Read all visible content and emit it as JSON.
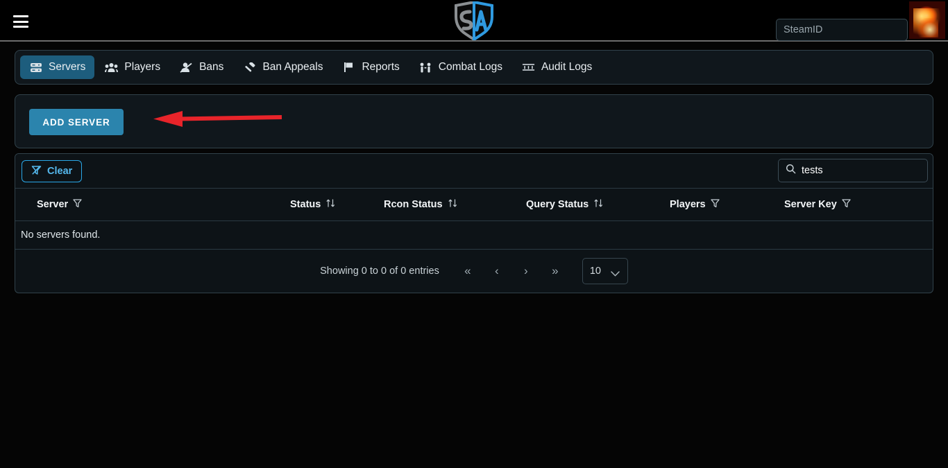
{
  "topbar": {
    "menu_icon": "hamburger-icon",
    "logo_alt": "SA shield logo",
    "logo_letters": "SA",
    "steamid": {
      "placeholder": "SteamID",
      "value": ""
    },
    "avatar_alt": "user-avatar"
  },
  "nav": {
    "items": [
      {
        "label": "Servers",
        "icon": "server-icon",
        "active": true
      },
      {
        "label": "Players",
        "icon": "users-icon",
        "active": false
      },
      {
        "label": "Bans",
        "icon": "user-slash-icon",
        "active": false
      },
      {
        "label": "Ban Appeals",
        "icon": "gavel-icon",
        "active": false
      },
      {
        "label": "Reports",
        "icon": "flag-icon",
        "active": false
      },
      {
        "label": "Combat Logs",
        "icon": "people-arrows-icon",
        "active": false
      },
      {
        "label": "Audit Logs",
        "icon": "list-lines-icon",
        "active": false
      }
    ]
  },
  "actions": {
    "add_server_label": "ADD SERVER",
    "annotation_arrow": {
      "color": "#e8242a",
      "direction": "left"
    }
  },
  "toolbar": {
    "clear_label": "Clear",
    "clear_icon": "filter-slash-icon",
    "search": {
      "icon": "search-icon",
      "value": "tests",
      "placeholder": ""
    }
  },
  "table": {
    "columns": [
      {
        "label": "Server",
        "control": "filter"
      },
      {
        "label": "Status",
        "control": "sort"
      },
      {
        "label": "Rcon Status",
        "control": "sort"
      },
      {
        "label": "Query Status",
        "control": "sort"
      },
      {
        "label": "Players",
        "control": "filter"
      },
      {
        "label": "Server Key",
        "control": "filter"
      }
    ],
    "rows": [],
    "empty_message": "No servers found."
  },
  "pagination": {
    "showing": "Showing 0 to 0 of 0 entries",
    "first": "«",
    "prev": "‹",
    "next": "›",
    "last": "»",
    "page_size": "10"
  },
  "colors": {
    "accent_blue": "#2b84ad",
    "active_tab": "#1d5d7d",
    "clear_blue": "#2aa8e8",
    "arrow_red": "#e8242a",
    "panel_bg": "#10171c",
    "page_bg": "#050505"
  }
}
